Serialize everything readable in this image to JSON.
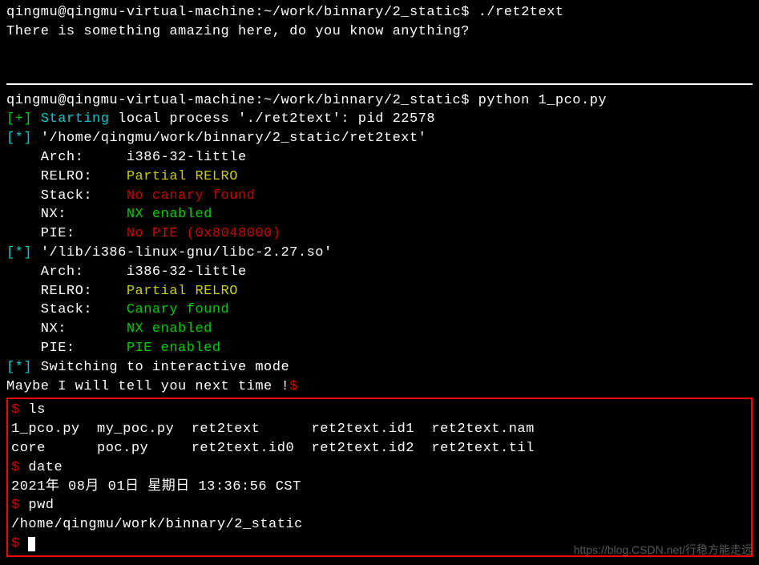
{
  "block1": {
    "prompt": "qingmu@qingmu-virtual-machine:~/work/binnary/2_static$ ",
    "cmd": "./ret2text",
    "out1": "There is something amazing here, do you know anything?"
  },
  "block2": {
    "prompt": "qingmu@qingmu-virtual-machine:~/work/binnary/2_static$ ",
    "cmd": "python 1_pco.py",
    "pwn": {
      "star_plus": "[+] ",
      "star_info": "[*] ",
      "starting": "Starting",
      "starting_rest": " local process './ret2text': pid 22578",
      "path1": "'/home/qingmu/work/binnary/2_static/ret2text'",
      "arch_lbl": "    Arch:     ",
      "arch_val": "i386-32-little",
      "relro_lbl": "    RELRO:    ",
      "relro_partial": "Partial RELRO",
      "stack_lbl": "    Stack:    ",
      "stack_nocanary": "No canary found",
      "nx_lbl": "    NX:       ",
      "nx_enabled": "NX enabled",
      "pie_lbl": "    PIE:      ",
      "pie_none": "No PIE (0x8048000)",
      "path2": "'/lib/i386-linux-gnu/libc-2.27.so'",
      "stack_canary": "Canary found",
      "pie_enabled": "PIE enabled",
      "switching": "Switching to interactive mode"
    },
    "msg": "Maybe I will tell you next time !",
    "dollar": "$"
  },
  "shell": {
    "p": "$ ",
    "ls": "ls",
    "ls_out1": "1_pco.py  my_poc.py  ret2text      ret2text.id1  ret2text.nam",
    "ls_out2": "core      poc.py     ret2text.id0  ret2text.id2  ret2text.til",
    "date": "date",
    "date_out": "2021年 08月 01日 星期日 13:36:56 CST",
    "pwd": "pwd",
    "pwd_out": "/home/qingmu/work/binnary/2_static"
  },
  "watermark": "https://blog.CSDN.net/行稳方能走远"
}
